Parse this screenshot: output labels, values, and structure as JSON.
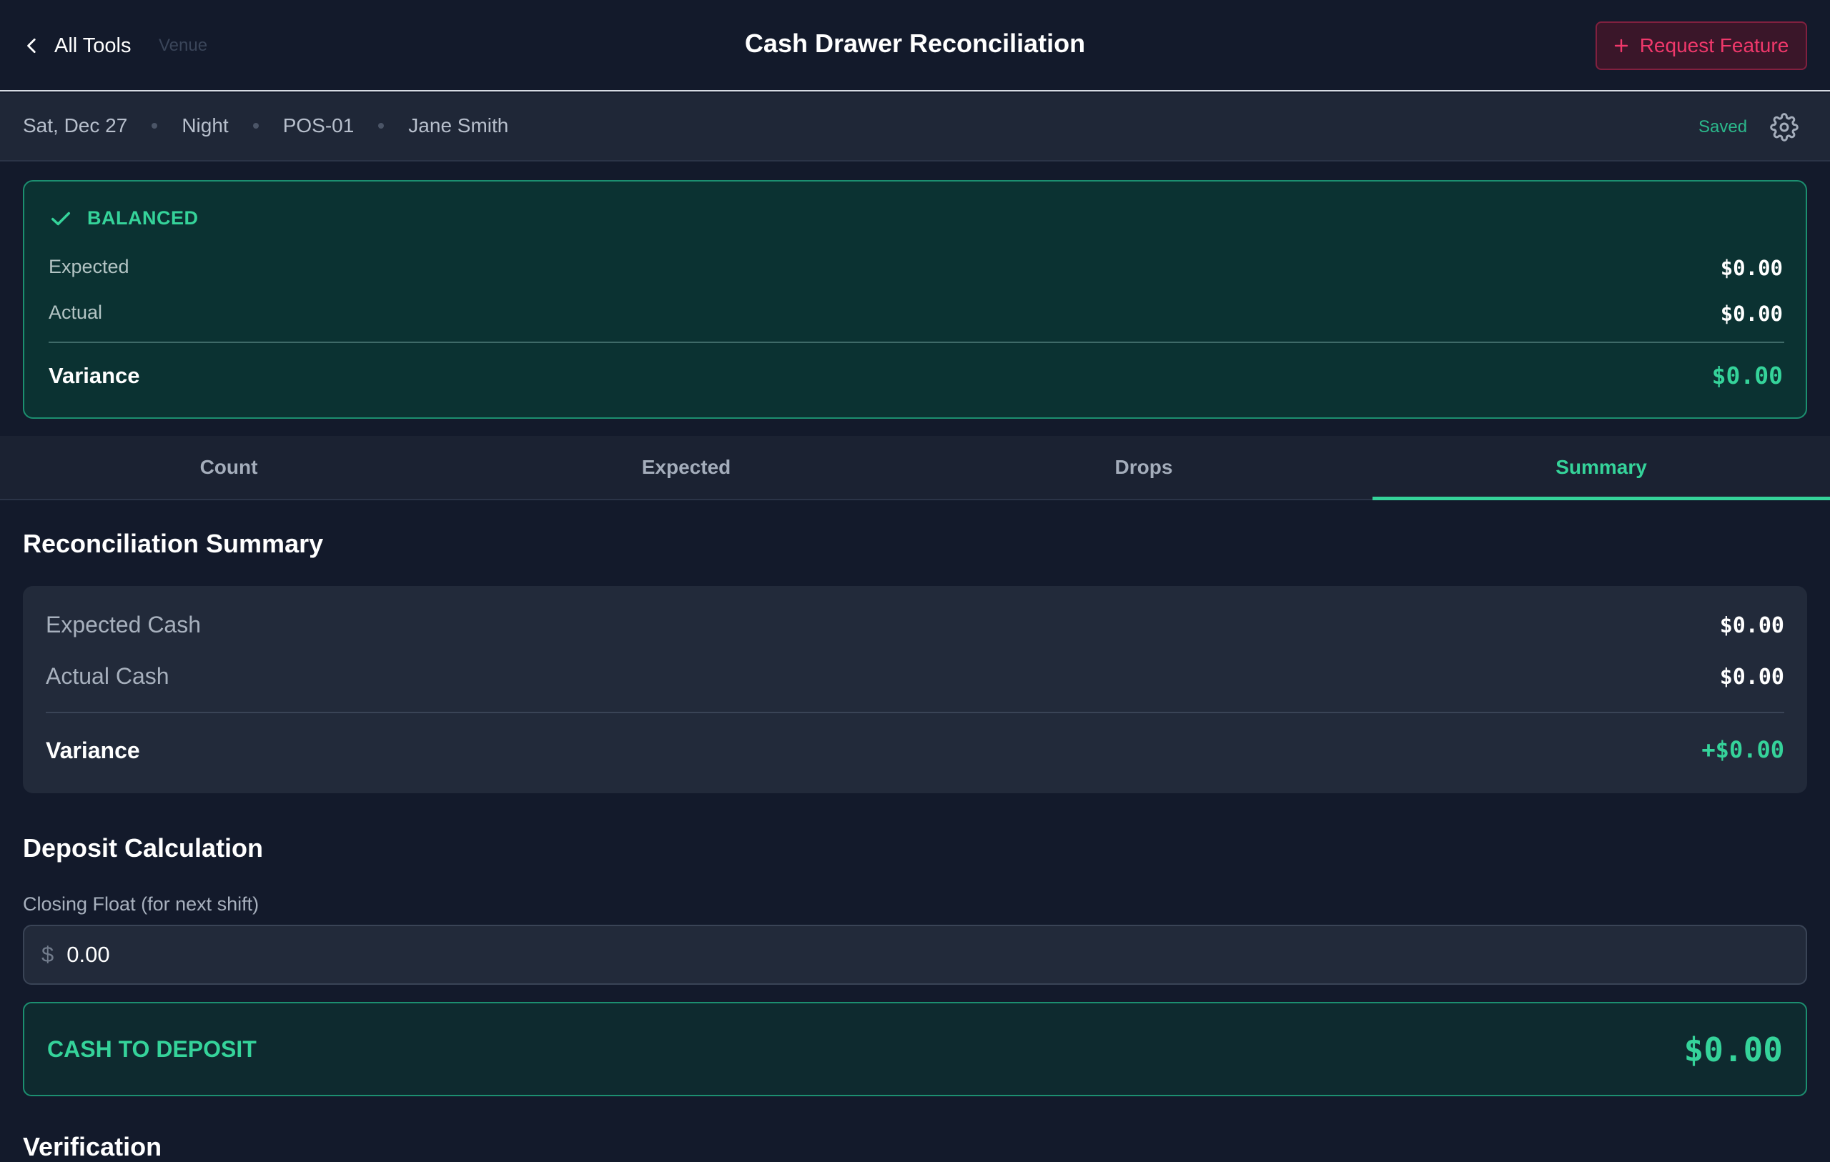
{
  "header": {
    "back_label": "All Tools",
    "venue_label": "Venue",
    "title": "Cash Drawer Reconciliation",
    "request_feature_label": "Request Feature"
  },
  "shift": {
    "date": "Sat, Dec 27",
    "period": "Night",
    "register": "POS-01",
    "cashier": "Jane Smith",
    "save_status": "Saved"
  },
  "balance_card": {
    "status": "BALANCED",
    "expected_label": "Expected",
    "expected_value": "$0.00",
    "actual_label": "Actual",
    "actual_value": "$0.00",
    "variance_label": "Variance",
    "variance_value": "$0.00"
  },
  "tabs": [
    {
      "label": "Count"
    },
    {
      "label": "Expected"
    },
    {
      "label": "Drops"
    },
    {
      "label": "Summary"
    }
  ],
  "active_tab": "Summary",
  "summary": {
    "heading": "Reconciliation Summary",
    "expected_cash_label": "Expected Cash",
    "expected_cash_value": "$0.00",
    "actual_cash_label": "Actual Cash",
    "actual_cash_value": "$0.00",
    "variance_label": "Variance",
    "variance_value": "+$0.00"
  },
  "deposit": {
    "heading": "Deposit Calculation",
    "closing_float_label": "Closing Float (for next shift)",
    "currency_symbol": "$",
    "closing_float_value": "0.00",
    "cash_to_deposit_label": "CASH TO DEPOSIT",
    "cash_to_deposit_value": "$0.00"
  },
  "next_section_heading": "Verification",
  "colors": {
    "background": "#131a2b",
    "accent_green": "#35d39a",
    "request_red": "#f0386b"
  }
}
